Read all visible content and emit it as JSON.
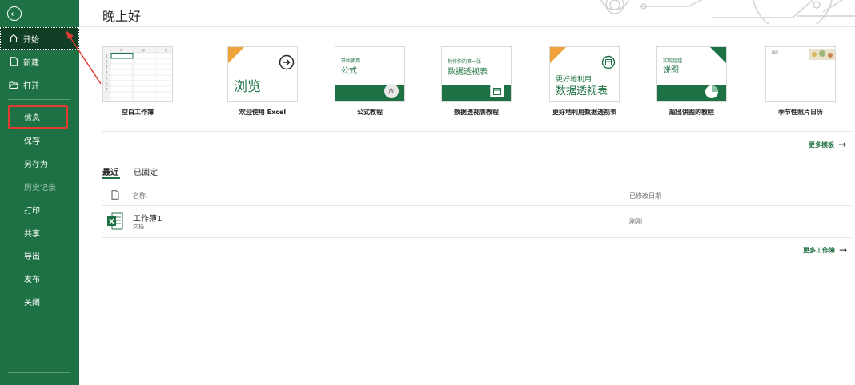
{
  "sidebar": {
    "top_items": [
      {
        "label": "开始",
        "icon": "home-icon"
      },
      {
        "label": "新建",
        "icon": "new-file-icon"
      },
      {
        "label": "打开",
        "icon": "folder-open-icon"
      }
    ],
    "sub_items": [
      {
        "label": "信息"
      },
      {
        "label": "保存"
      },
      {
        "label": "另存为"
      },
      {
        "label": "历史记录"
      },
      {
        "label": "打印"
      },
      {
        "label": "共享"
      },
      {
        "label": "导出"
      },
      {
        "label": "发布"
      },
      {
        "label": "关闭"
      }
    ]
  },
  "header": {
    "greeting": "晚上好"
  },
  "templates": [
    {
      "caption": "空白工作簿"
    },
    {
      "caption": "欢迎使用 Excel",
      "thumb_text": "浏览"
    },
    {
      "caption": "公式教程",
      "thumb_small": "开始使用",
      "thumb_big": "公式",
      "badge": "fx"
    },
    {
      "caption": "数据透视表教程",
      "thumb_small": "制作你的第一张",
      "thumb_big": "数据透视表"
    },
    {
      "caption": "更好地利用数据透视表",
      "thumb_small": "更好地利用",
      "thumb_big": "数据透视表"
    },
    {
      "caption": "超出饼图的教程",
      "thumb_small": "实现超越",
      "thumb_big": "饼图"
    },
    {
      "caption": "季节性照片日历",
      "thumb_small": "四月"
    }
  ],
  "more_templates": "更多模板",
  "tabs": {
    "recent": "最近",
    "pinned": "已固定"
  },
  "list": {
    "col_name": "名称",
    "col_modified": "已修改日期",
    "files": [
      {
        "name": "工作簿1",
        "location": "文档",
        "modified": "刚刚"
      }
    ]
  },
  "more_workbooks": "更多工作簿",
  "colors": {
    "accent": "#1e7145",
    "highlight": "#e03c31",
    "ribbon": "#f0a33a"
  }
}
